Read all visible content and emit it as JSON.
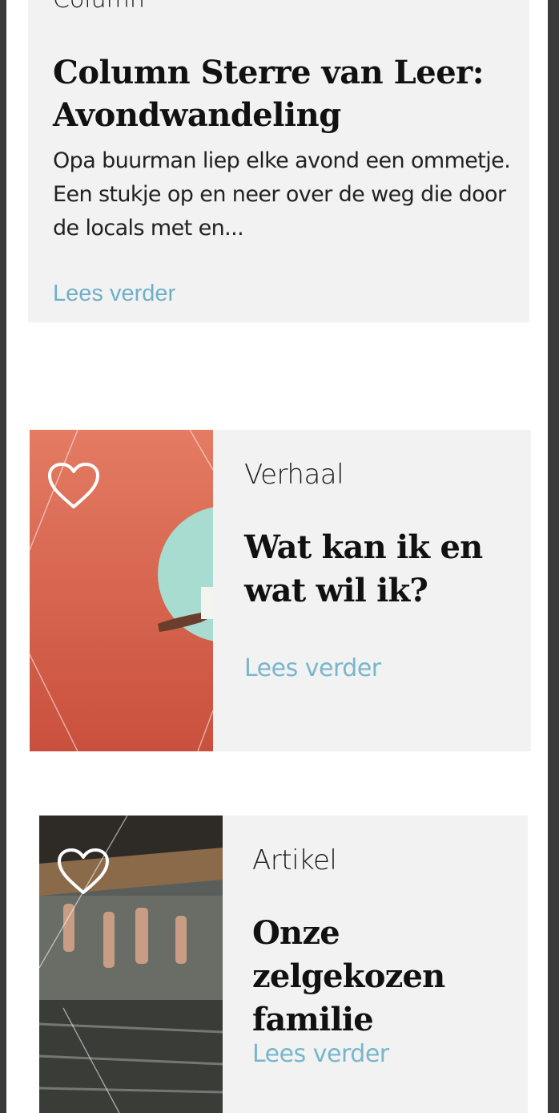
{
  "cards": [
    {
      "category": "Column",
      "title": "Column Sterre van Leer: Avondwandeling",
      "excerpt": "Opa buurman liep elke avond een ommetje. Een stukje op en neer over de weg die door de locals met en...",
      "read_more": "Lees verder"
    },
    {
      "category": "Verhaal",
      "title": "Wat kan ik en wat wil ik?",
      "read_more": "Lees verder",
      "favorite_icon": "heart-icon"
    },
    {
      "category": "Artikel",
      "title": "Onze zelgekozen familie",
      "read_more": "Lees verder",
      "favorite_icon": "heart-icon"
    }
  ],
  "colors": {
    "card_background": "#f2f2f2",
    "link": "#78b6cc",
    "card2_image": "#e0705a",
    "accent_circle": "#a9dcd0"
  }
}
